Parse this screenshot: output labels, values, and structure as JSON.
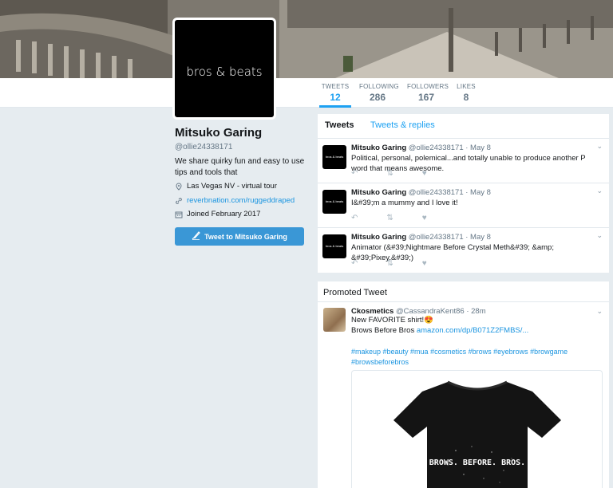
{
  "brand": {
    "accent": "#1da1f2"
  },
  "stats": [
    {
      "label": "TWEETS",
      "value": "12"
    },
    {
      "label": "FOLLOWING",
      "value": "286"
    },
    {
      "label": "FOLLOWERS",
      "value": "167"
    },
    {
      "label": "LIKES",
      "value": "8"
    }
  ],
  "avatar": {
    "text": "bros & beats"
  },
  "profile": {
    "name": "Mitsuko Garing",
    "handle": "@ollie24338171",
    "bio": "We share quirky fun and easy to use tips and tools that",
    "location": "Las Vegas NV - virtual tour",
    "website": "reverbnation.com/ruggeddraped",
    "joined": "Joined February 2017",
    "tweet_to_label": "Tweet to Mitsuko Garing"
  },
  "timeline": {
    "tabs": [
      "Tweets",
      "Tweets & replies"
    ],
    "tweets": [
      {
        "name": "Mitsuko Garing",
        "handle": "@ollie24338171",
        "date": "· May 8",
        "avatar_text": "bros & beats",
        "text": "Political, personal, polemical...and totally unable to produce another P word that means awesome."
      },
      {
        "name": "Mitsuko Garing",
        "handle": "@ollie24338171",
        "date": "· May 8",
        "avatar_text": "bros & beats",
        "text": "I&#39;m a mummy and I love it!"
      },
      {
        "name": "Mitsuko Garing",
        "handle": "@ollie24338171",
        "date": "· May 8",
        "avatar_text": "bros & beats",
        "text": "Animator (&#39;Nightmare Before Crystal Meth&#39; &amp; &#39;Pixey.&#39;)"
      }
    ]
  },
  "promoted": {
    "title": "Promoted Tweet",
    "name": "Ckosmetics",
    "handle": "@CassandraKent86",
    "time": "· 28m",
    "line1": "New FAVORITE shirt!😍",
    "line2_text": "Brows Before Bros ",
    "line2_link": "amazon.com/dp/B071Z2FMBS/...",
    "hashtags": "#makeup #beauty #mua #cosmetics #brows #eyebrows #browgame #browsbeforebros",
    "shirt_text": "BROWS. BEFORE. BROS."
  },
  "icons": [
    "location-icon",
    "link-icon",
    "calendar-icon",
    "quill-icon",
    "reply-icon",
    "retweet-icon",
    "heart-icon",
    "caret-down-icon"
  ]
}
